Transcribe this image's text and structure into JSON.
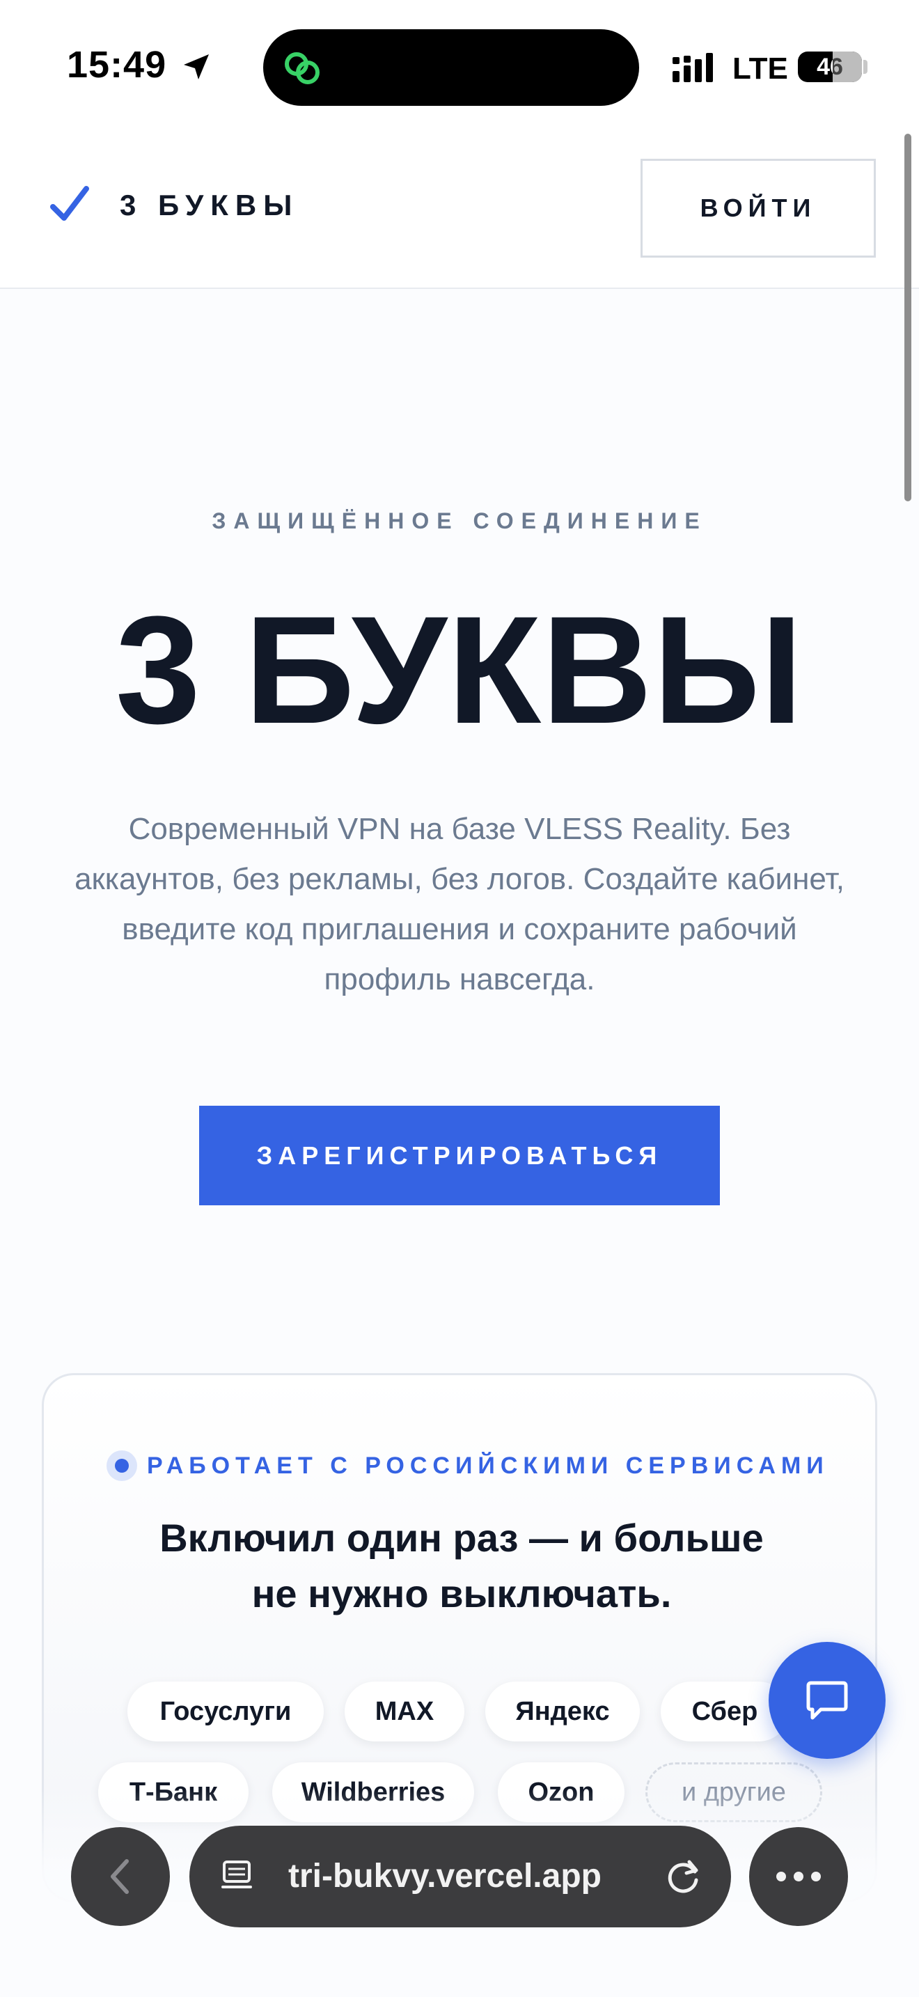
{
  "status_bar": {
    "time": "15:49",
    "network": "LTE",
    "battery": "46"
  },
  "header": {
    "brand_name": "3 БУКВЫ",
    "login_label": "ВОЙТИ"
  },
  "hero": {
    "eyebrow": "ЗАЩИЩЁННОЕ СОЕДИНЕНИЕ",
    "title": "3 БУКВЫ",
    "description": "Современный VPN на базе VLESS Reality. Без аккаунтов, без рекламы, без логов. Создайте кабинет, введите код приглашения и сохраните рабочий профиль навсегда.",
    "cta_label": "ЗАРЕГИСТРИРОВАТЬСЯ"
  },
  "services_card": {
    "eyebrow": "РАБОТАЕТ С РОССИЙСКИМИ СЕРВИСАМИ",
    "title_line1": "Включил один раз — и больше",
    "title_line2": "не нужно выключать.",
    "chips": [
      "Госуслуги",
      "MAX",
      "Яндекс",
      "Сбер",
      "Т-Банк",
      "Wildberries",
      "Ozon",
      "и другие"
    ]
  },
  "browser": {
    "url": "tri-bukvy.vercel.app"
  },
  "colors": {
    "accent": "#3563e3",
    "text": "#111827",
    "muted": "#6b7a90"
  },
  "icons": {
    "location": "location-arrow-icon",
    "island": "link-rings-icon",
    "brand": "checkmark-icon",
    "chat": "chat-bubble-icon",
    "back": "chevron-left-icon",
    "tabs": "tabs-icon",
    "reload": "reload-icon",
    "more": "ellipsis-icon"
  }
}
